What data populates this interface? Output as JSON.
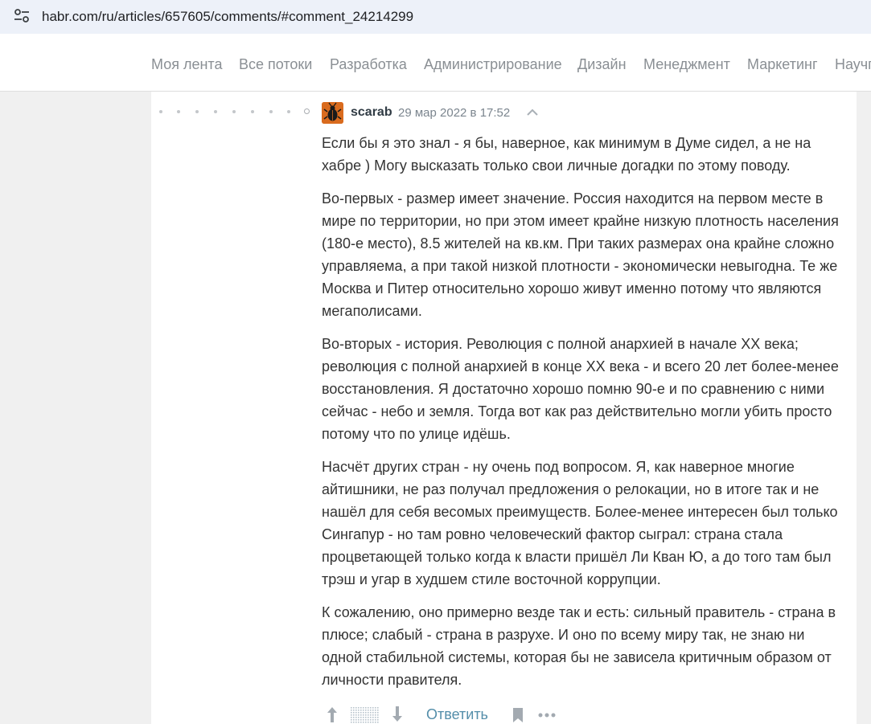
{
  "browser": {
    "url": "habr.com/ru/articles/657605/comments/#comment_24214299",
    "site_settings_icon": "tune-icon"
  },
  "nav": {
    "items": [
      "Моя лента",
      "Все потоки",
      "Разработка",
      "Администрирование",
      "Дизайн",
      "Менеджмент",
      "Маркетинг",
      "Научпоп"
    ]
  },
  "comment": {
    "author": "scarab",
    "date": "29 мар 2022 в 17:52",
    "avatar_color": "#d96b1e",
    "paragraphs": [
      "Если бы я это знал - я бы, наверное, как минимум в Думе сидел, а не на хабре ) Могу высказать только свои личные догадки по этому поводу.",
      "Во-первых - размер имеет значение. Россия находится на первом месте в мире по территории, но при этом имеет крайне низкую плотность населения (180-е место), 8.5 жителей на кв.км. При таких размерах она крайне сложно управляема, а при такой низкой плотности - экономически невыгодна. Те же Москва и Питер относительно хорошо живут именно потому что являются мегаполисами.",
      "Во-вторых - история. Революция с полной анархией в начале XX века; революция с полной анархией в конце XX века - и всего 20 лет более-менее восстановления. Я достаточно хорошо помню 90-е и по сравнению с ними сейчас - небо и земля. Тогда вот как раз действительно могли убить просто потому что по улице идёшь.",
      "Насчёт других стран - ну очень под вопросом. Я, как наверное многие айтишники, не раз получал предложения о релокации, но в итоге так и не нашёл для себя весомых преимуществ. Более-менее интересен был только Сингапур - но там ровно человеческий фактор сыграл: страна стала процветающей только когда к власти пришёл Ли Кван Ю, а до того там был трэш и угар в худшем стиле восточной коррупции.",
      "К сожалению, оно примерно везде так и есть: сильный правитель - страна в плюсе; слабый - страна в разрухе. И оно по всему миру так, не знаю ни одной стабильной системы, которая бы не зависела критичным образом от личности правителя."
    ],
    "actions": {
      "reply_label": "Ответить",
      "vote_up_icon": "arrow-up-icon",
      "vote_down_icon": "arrow-down-icon",
      "bookmark_icon": "bookmark-icon",
      "more_icon": "more-dots-icon"
    }
  },
  "colors": {
    "link": "#548eaa",
    "nav_text": "#8a8f94",
    "body_text": "#333333"
  }
}
